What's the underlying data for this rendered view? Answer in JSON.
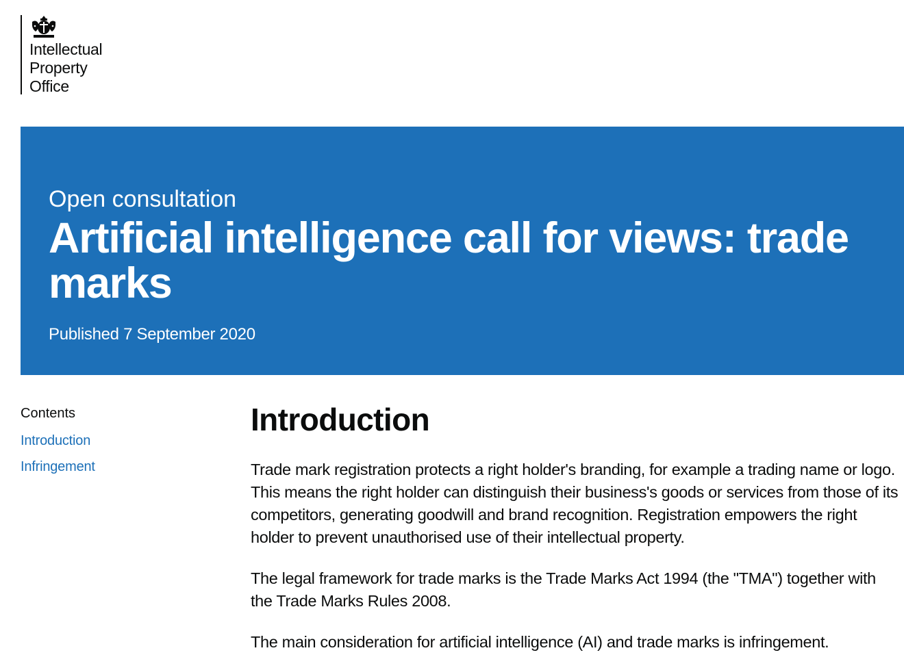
{
  "header": {
    "org_name_lines": [
      "Intellectual",
      "Property",
      "Office"
    ],
    "logo_icon": "royal-crest-icon"
  },
  "banner": {
    "kicker": "Open consultation",
    "title": "Artificial intelligence call for views: trade marks",
    "published": "Published 7 September 2020",
    "background_color": "#1d70b8"
  },
  "contents": {
    "heading": "Contents",
    "items": [
      {
        "label": "Introduction"
      },
      {
        "label": "Infringement"
      }
    ]
  },
  "main": {
    "heading": "Introduction",
    "paragraphs": [
      "Trade mark registration protects a right holder's branding, for example a trading name or logo. This means the right holder can distinguish their business's goods or services from those of its competitors, generating goodwill and brand recognition. Registration empowers the right holder to prevent unauthorised use of their intellectual property.",
      "The legal framework for trade marks is the Trade Marks Act 1994 (the \"TMA\") together with the Trade Marks Rules 2008.",
      "The main consideration for artificial intelligence (AI) and trade marks is infringement."
    ]
  },
  "colors": {
    "link": "#1d70b8",
    "text": "#0b0c0c"
  }
}
